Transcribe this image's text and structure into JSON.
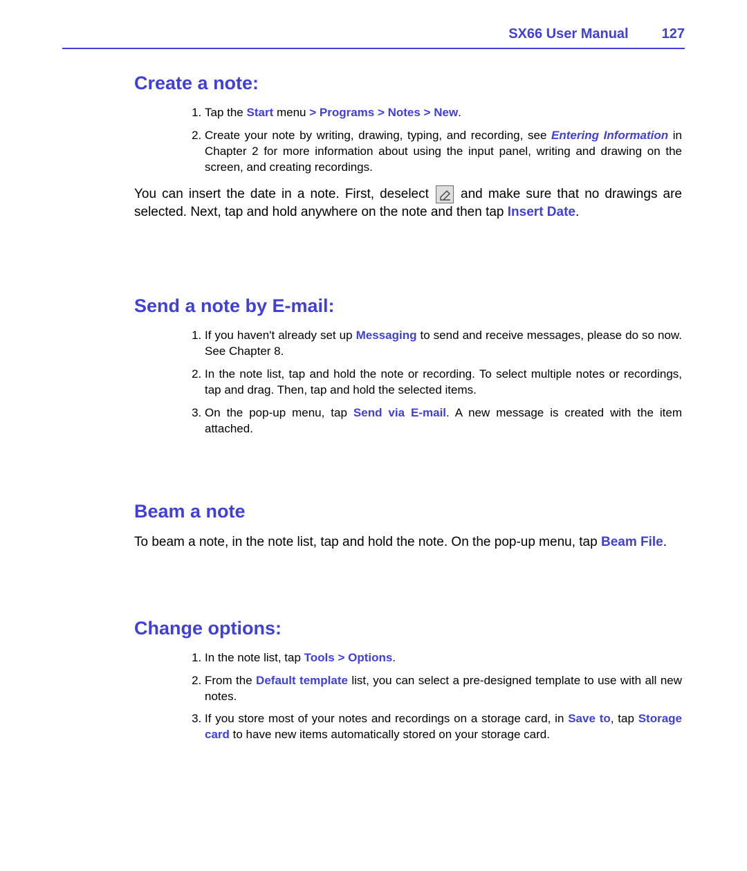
{
  "header": {
    "title": "SX66 User Manual",
    "page": "127"
  },
  "sections": {
    "create_note": {
      "heading": "Create a note:",
      "step1_prefix": "Tap the ",
      "step1_hl": "Start ",
      "step1_mid": "menu ",
      "step1_hl2": "> Programs > Notes > New",
      "step1_suffix": ".",
      "step2_prefix": "Create your note by writing, drawing, typing, and recording, see ",
      "step2_hl": "Entering Information",
      "step2_suffix": " in Chapter 2 for more information about using the input panel, writing and drawing on the screen, and creating recordings.",
      "body_prefix": "You can insert the date in a note. First, deselect ",
      "body_mid": " and make sure that no drawings are selected. Next, tap and hold anywhere on the note and then tap ",
      "body_hl": "Insert Date",
      "body_suffix": "."
    },
    "send_email": {
      "heading": "Send a note by E-mail:",
      "step1_prefix": "If you haven't already set up ",
      "step1_hl": "Messaging",
      "step1_suffix": " to send and receive messages, please do so now. See Chapter 8.",
      "step2": "In the note list, tap and hold the note or recording. To select multiple notes or recordings, tap and drag. Then, tap and hold the selected items.",
      "step3_prefix": "On the pop-up menu, tap ",
      "step3_hl": "Send via E-mail",
      "step3_suffix": ". A new message is created with the item attached."
    },
    "beam_note": {
      "heading": "Beam a note",
      "body_prefix": "To beam a note, in the note list, tap and hold the note. On the pop-up menu, tap ",
      "body_hl": "Beam File",
      "body_suffix": "."
    },
    "change_options": {
      "heading": "Change options:",
      "step1_prefix": "In the note list, tap ",
      "step1_hl": "Tools > Options",
      "step1_suffix": ".",
      "step2_prefix": "From the ",
      "step2_hl": "Default template",
      "step2_suffix": " list, you can select a pre-designed template to use with all new notes.",
      "step3_prefix": "If you store most of your notes and recordings on a storage card, in ",
      "step3_hl1": "Save to",
      "step3_mid": ", tap ",
      "step3_hl2": "Storage card",
      "step3_suffix": " to have new items automatically stored on your storage card."
    }
  }
}
